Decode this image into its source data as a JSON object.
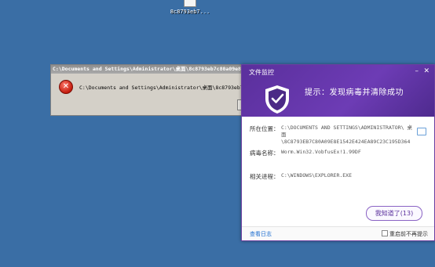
{
  "desktop": {
    "file_label": "8c8793eb7..."
  },
  "error_dialog": {
    "title": "C:\\Documents and Settings\\Administrator\\桌面\\8c8793eb7c80a09e8e1542e424ea89c23c195d364",
    "message": "C:\\Documents and Settings\\Administrator\\桌面\\8c8793eb7c80a09e8e1542e424ea89c23c195d364",
    "icon": "error-icon"
  },
  "av_popup": {
    "title": "文件监控",
    "headline": "提示：发现病毒并清除成功",
    "location_label": "所在位置：",
    "location_value": "C:\\DOCUMENTS AND SETTINGS\\ADMINISTRATOR\\ 桌面 \\8C8793EB7C80A09E8E1542E424EA89C23C195D364",
    "virus_label": "病毒名称：",
    "virus_value": "Worm.Win32.VobfusEx!1.99DF",
    "process_label": "相关进程：",
    "process_value": "C:\\WINDOWS\\EXPLORER.EXE",
    "ok_button": "我知道了(13)",
    "view_log": "查看日志",
    "no_remind": "重启前不再提示",
    "colors": {
      "header": "#5a2f9c",
      "link": "#1e6fd0"
    }
  }
}
